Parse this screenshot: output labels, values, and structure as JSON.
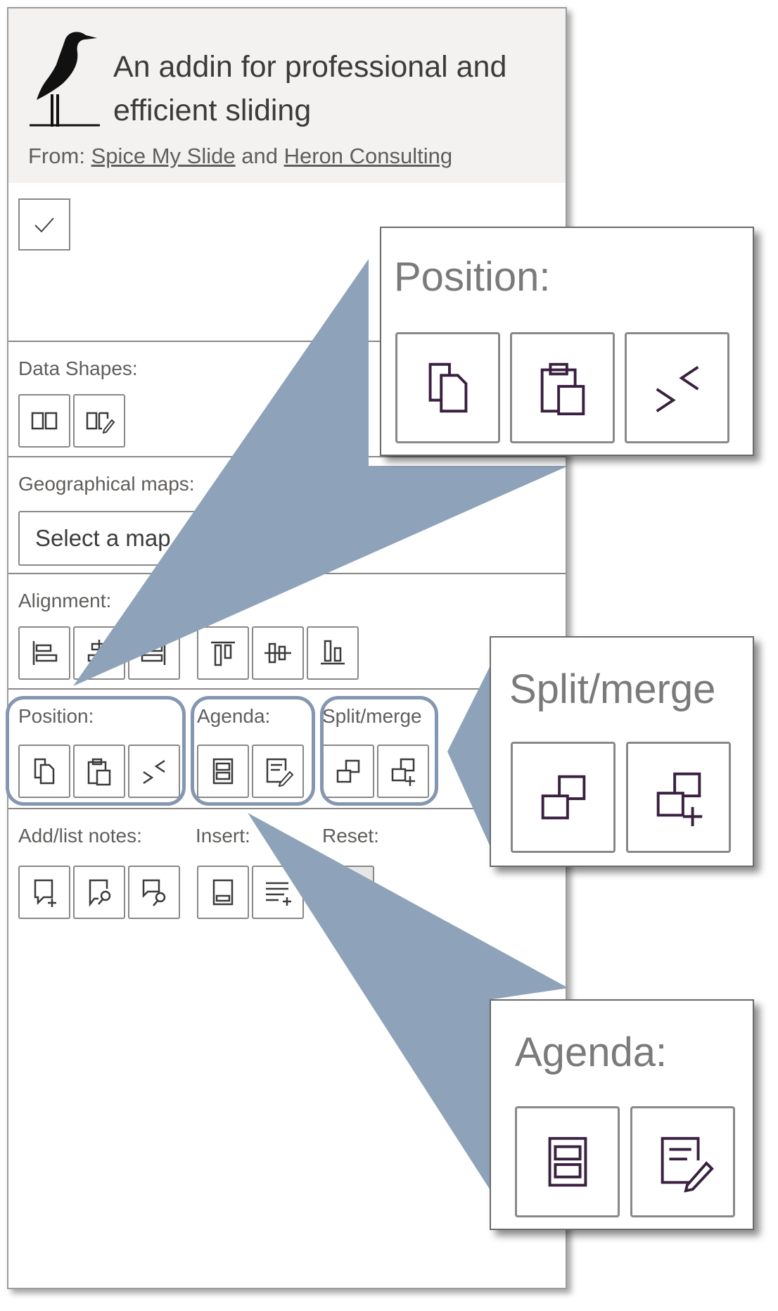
{
  "header": {
    "title_line1": "An addin for professional and",
    "title_line2": "efficient sliding",
    "from_prefix": "From:",
    "from_link1": "Spice My Slide",
    "from_and": "and",
    "from_link2": "Heron Consulting"
  },
  "sections": {
    "data_shapes": "Data Shapes:",
    "geo_maps": "Geographical maps:",
    "alignment": "Alignment:",
    "position": "Position:",
    "agenda": "Agenda:",
    "split_merge": "Split/merge",
    "add_list_notes": "Add/list notes:",
    "insert": "Insert:",
    "reset": "Reset:"
  },
  "map_select": {
    "value": "Select a map"
  },
  "callouts": {
    "position_title": "Position:",
    "split_title": "Split/merge",
    "agenda_title": "Agenda:"
  },
  "colors": {
    "callout_blue": "#8ea3ba",
    "group_outline": "#8497b0",
    "icon_stroke": "#3a3a3a",
    "icon_accent": "#c0007a"
  }
}
